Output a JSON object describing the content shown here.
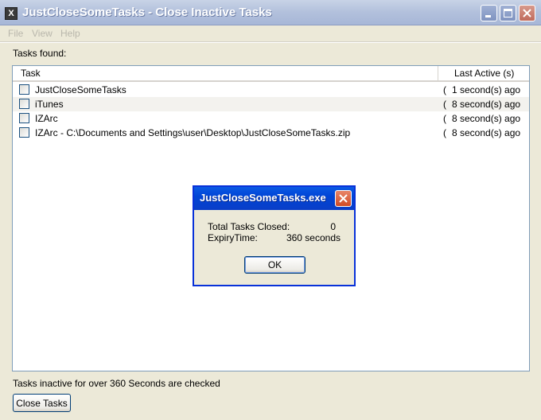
{
  "window": {
    "title": "JustCloseSomeTasks - Close Inactive Tasks",
    "app_icon_glyph": "X"
  },
  "menu": [
    "File",
    "View",
    "Help"
  ],
  "tasks_found_label": "Tasks found:",
  "columns": {
    "task": "Task",
    "last_active": "Last Active (s)"
  },
  "rows": [
    {
      "task": "JustCloseSomeTasks",
      "trunc": "(",
      "last_active": "1 second(s) ago",
      "checked": false
    },
    {
      "task": "iTunes",
      "trunc": "(",
      "last_active": "8 second(s) ago",
      "checked": false
    },
    {
      "task": "IZArc",
      "trunc": "(",
      "last_active": "8 second(s) ago",
      "checked": false
    },
    {
      "task": "IZArc - C:\\Documents and Settings\\user\\Desktop\\JustCloseSomeTasks.zip",
      "trunc": "(",
      "last_active": "8 second(s) ago",
      "checked": false
    }
  ],
  "status_text": "Tasks inactive for over 360 Seconds are checked",
  "close_tasks_label": "Close Tasks",
  "dialog": {
    "title": "JustCloseSomeTasks.exe",
    "total_label": "Total Tasks Closed:",
    "total_value": "0",
    "expiry_label": "ExpiryTime:",
    "expiry_value": "360 seconds",
    "ok_label": "OK"
  },
  "colors": {
    "titlebar": "#b2c0dc",
    "dialog_titlebar": "#0045d6",
    "face": "#ece9d8"
  }
}
